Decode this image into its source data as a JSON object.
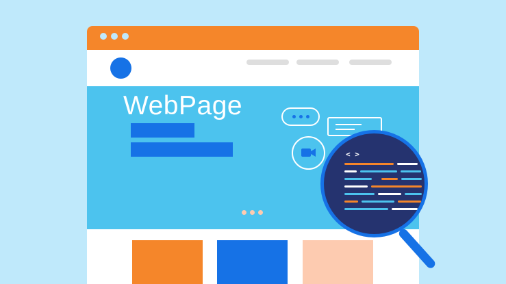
{
  "hero": {
    "title": "WebPage"
  },
  "lens": {
    "code_tag": "< >"
  },
  "colors": {
    "background": "#bfe9fb",
    "titlebar": "#f5862a",
    "hero": "#4cc3ee",
    "accent_blue": "#1672e6",
    "card_orange": "#f5862a",
    "card_blue": "#1672e6",
    "card_peach": "#fdcbb0",
    "lens_bg": "#25336f"
  },
  "icons": [
    "window-control-dot",
    "logo-circle",
    "chat-dots-icon",
    "message-card-icon",
    "video-camera-icon",
    "magnifier-icon",
    "code-brackets-icon"
  ]
}
